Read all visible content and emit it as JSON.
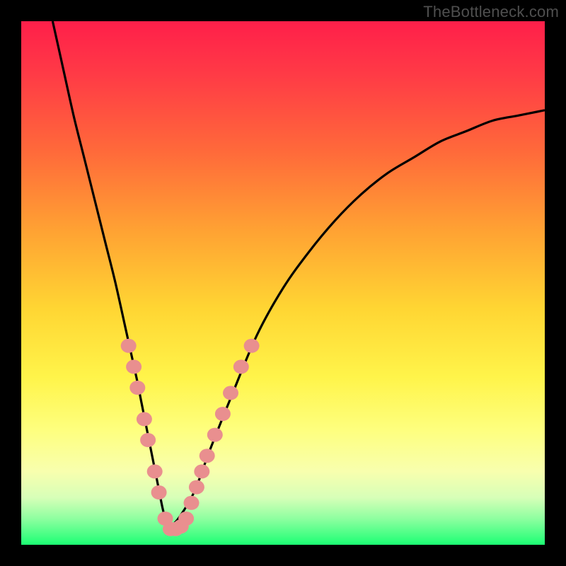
{
  "watermark": "TheBottleneck.com",
  "colors": {
    "frame": "#000000",
    "curve": "#000000",
    "dot_fill": "#e98f8f",
    "dot_stroke": "#c97272",
    "gradient_top": "#ff1f4a",
    "gradient_bottom": "#1cff74"
  },
  "chart_data": {
    "type": "line",
    "title": "",
    "xlabel": "",
    "ylabel": "",
    "xlim": [
      0,
      100
    ],
    "ylim": [
      0,
      100
    ],
    "grid": false,
    "legend": false,
    "series": [
      {
        "name": "left-branch",
        "x": [
          6,
          8,
          10,
          12,
          14,
          16,
          18,
          20,
          22,
          23,
          24,
          25,
          26,
          27,
          28
        ],
        "y": [
          100,
          91,
          82,
          74,
          66,
          58,
          50,
          41,
          32,
          27,
          22,
          17,
          12,
          7,
          3
        ]
      },
      {
        "name": "right-branch",
        "x": [
          28,
          30,
          33,
          36,
          40,
          45,
          50,
          55,
          60,
          65,
          70,
          75,
          80,
          85,
          90,
          95,
          100
        ],
        "y": [
          3,
          5,
          10,
          18,
          28,
          40,
          49,
          56,
          62,
          67,
          71,
          74,
          77,
          79,
          81,
          82,
          83
        ]
      }
    ],
    "markers": [
      {
        "x": 20.5,
        "y": 38
      },
      {
        "x": 21.5,
        "y": 34
      },
      {
        "x": 22.2,
        "y": 30
      },
      {
        "x": 23.5,
        "y": 24
      },
      {
        "x": 24.2,
        "y": 20
      },
      {
        "x": 25.5,
        "y": 14
      },
      {
        "x": 26.3,
        "y": 10
      },
      {
        "x": 27.5,
        "y": 5
      },
      {
        "x": 28.5,
        "y": 3
      },
      {
        "x": 29.5,
        "y": 3
      },
      {
        "x": 30.5,
        "y": 3.5
      },
      {
        "x": 31.5,
        "y": 5
      },
      {
        "x": 32.5,
        "y": 8
      },
      {
        "x": 33.5,
        "y": 11
      },
      {
        "x": 34.5,
        "y": 14
      },
      {
        "x": 35.5,
        "y": 17
      },
      {
        "x": 37,
        "y": 21
      },
      {
        "x": 38.5,
        "y": 25
      },
      {
        "x": 40,
        "y": 29
      },
      {
        "x": 42,
        "y": 34
      },
      {
        "x": 44,
        "y": 38
      }
    ]
  }
}
